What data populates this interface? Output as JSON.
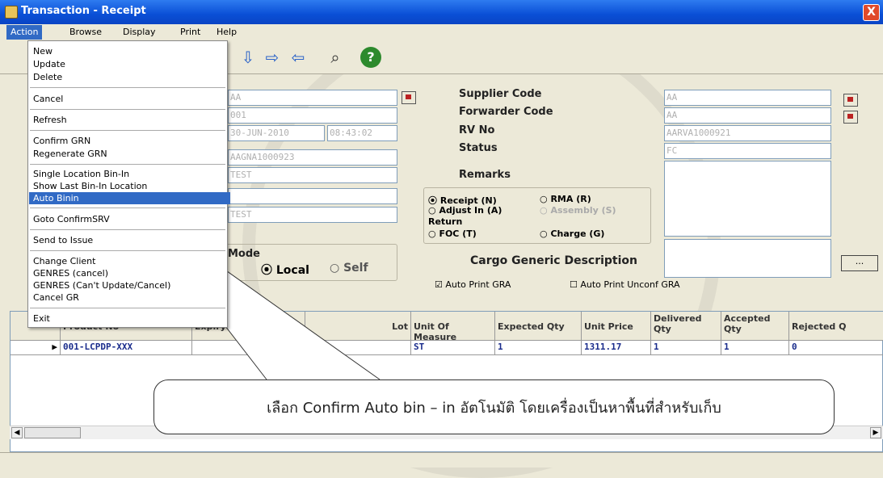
{
  "window": {
    "title": "Transaction - Receipt",
    "close_label": "X"
  },
  "menubar": [
    "Action",
    "Browse",
    "Display",
    "Print",
    "Help"
  ],
  "action_menu": {
    "items": [
      "New",
      "Update",
      "Delete",
      "Cancel",
      "Refresh",
      "Confirm GRN",
      "Regenerate GRN",
      "Single Location  Bin-In",
      "Show Last Bin-In Location",
      "Auto Binin",
      "Goto ConfirmSRV",
      "Send to Issue",
      "Change Client",
      "GENRES (cancel)",
      "GENRES (Can't Update/Cancel)",
      "Cancel GR",
      "Exit"
    ],
    "highlighted": "Auto Binin"
  },
  "form": {
    "left_values": [
      "AA",
      "001",
      "30-JUN-2010",
      "08:43:02",
      "AAGNA1000923",
      "TEST",
      "",
      "TEST"
    ],
    "supplier_code_label": "Supplier Code",
    "forwarder_code_label": "Forwarder Code",
    "rv_no_label": "RV No",
    "status_label": "Status",
    "remarks_label": "Remarks",
    "supplier_code": "AA",
    "forwarder_code": "AA",
    "rv_no": "AARVA1000921",
    "status": "FC",
    "mode_label": "Mode",
    "mode_local": "Local",
    "mode_self": "Self",
    "cargo_label": "Cargo Generic Description",
    "receipt_types": {
      "receipt": "Receipt (N)",
      "rma": "RMA (R)",
      "adjust_in": "Adjust In (A)",
      "assembly": "Assembly (S)",
      "return_label": "Return",
      "foc": "FOC (T)",
      "charge": "Charge (G)"
    },
    "auto_print_gra": "Auto Print GRA",
    "auto_print_unconf": "Auto Print Unconf GRA",
    "ellipsis": "..."
  },
  "grid": {
    "columns": [
      "Product No",
      "Expiry",
      "Lot",
      "Unit Of Measure",
      "Expected Qty",
      "Unit Price",
      "Delivered Qty",
      "Accepted Qty",
      "Rejected Q"
    ],
    "rows": [
      {
        "product_no": "001-LCPDP-XXX",
        "expiry": "",
        "lot": "",
        "uom": "ST",
        "expected": "1",
        "unit_price": "1311.17",
        "delivered": "1",
        "accepted": "1",
        "rejected": "0"
      }
    ]
  },
  "callout_text": "เลือก Confirm Auto bin – in อัตโนมัติ โดยเครื่องเป็นหาพื้นที่สำหรับเก็บ",
  "colors": {
    "titlebar": "#0a4fd6",
    "highlight": "#316ac5",
    "field_border": "#7f9db9"
  }
}
